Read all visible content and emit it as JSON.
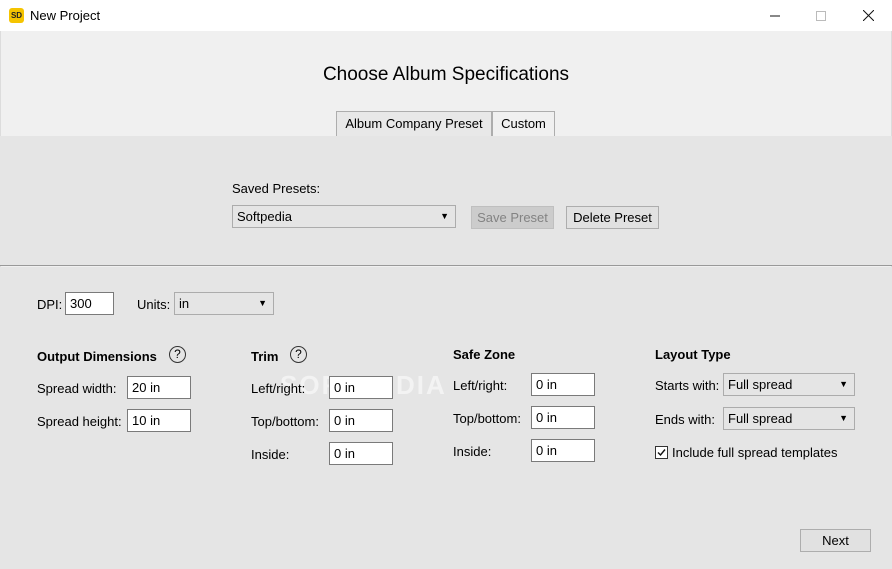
{
  "window": {
    "title": "New Project",
    "app_icon_text": "SD"
  },
  "heading": "Choose Album Specifications",
  "tabs": [
    {
      "label": "Album Company Preset"
    },
    {
      "label": "Custom"
    }
  ],
  "presets": {
    "label": "Saved Presets:",
    "selected": "Softpedia",
    "save_label": "Save Preset",
    "delete_label": "Delete Preset"
  },
  "dpi": {
    "label": "DPI:",
    "value": "300"
  },
  "units": {
    "label": "Units:",
    "value": "in"
  },
  "output": {
    "title": "Output Dimensions",
    "spread_width_label": "Spread width:",
    "spread_width": "20 in",
    "spread_height_label": "Spread height:",
    "spread_height": "10 in"
  },
  "trim": {
    "title": "Trim",
    "left_right_label": "Left/right:",
    "left_right": "0 in",
    "top_bottom_label": "Top/bottom:",
    "top_bottom": "0 in",
    "inside_label": "Inside:",
    "inside": "0 in"
  },
  "safe_zone": {
    "title": "Safe Zone",
    "left_right_label": "Left/right:",
    "left_right": "0 in",
    "top_bottom_label": "Top/bottom:",
    "top_bottom": "0 in",
    "inside_label": "Inside:",
    "inside": "0 in"
  },
  "layout": {
    "title": "Layout Type",
    "starts_label": "Starts with:",
    "starts": "Full spread",
    "ends_label": "Ends with:",
    "ends": "Full spread",
    "include_label": "Include full spread templates",
    "include_checked": true
  },
  "help_glyph": "?",
  "next_label": "Next",
  "watermark": "SOFTPEDIA"
}
